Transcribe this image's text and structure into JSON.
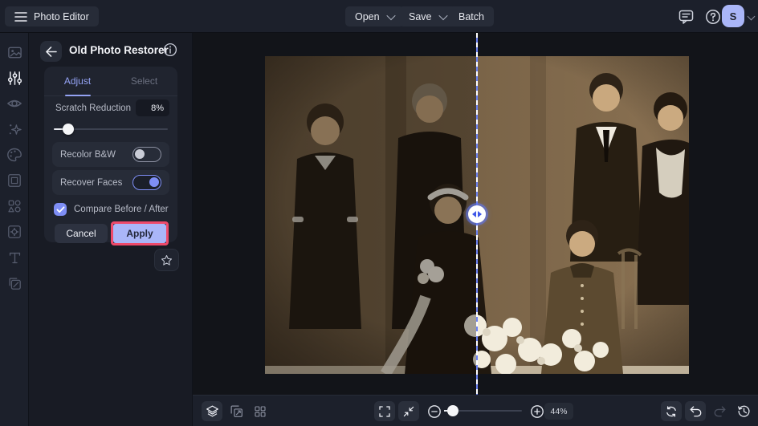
{
  "app": {
    "title": "Photo Editor"
  },
  "topbar": {
    "open_label": "Open",
    "save_label": "Save",
    "batch_label": "Batch",
    "avatar_initial": "S",
    "icons": [
      "hamburger-icon",
      "feedback-icon",
      "help-icon",
      "account-chevron-icon"
    ]
  },
  "tool_rail": {
    "items": [
      {
        "name": "image-tool-icon",
        "active": false
      },
      {
        "name": "adjust-tool-icon",
        "active": true
      },
      {
        "name": "eye-tool-icon",
        "active": false
      },
      {
        "name": "effects-tool-icon",
        "active": false
      },
      {
        "name": "paint-tool-icon",
        "active": false
      },
      {
        "name": "frame-tool-icon",
        "active": false
      },
      {
        "name": "elements-tool-icon",
        "active": false
      },
      {
        "name": "sticker-tool-icon",
        "active": false
      },
      {
        "name": "text-tool-icon",
        "active": false
      },
      {
        "name": "duplicate-tool-icon",
        "active": false
      }
    ]
  },
  "panel": {
    "title": "Old Photo Restorer",
    "tabs": [
      {
        "label": "Adjust",
        "active": true
      },
      {
        "label": "Select",
        "active": false
      }
    ],
    "scratch_reduction": {
      "label": "Scratch Reduction",
      "value": "8%",
      "slider_percent": 12
    },
    "toggles": [
      {
        "label": "Recolor B&W",
        "on": false
      },
      {
        "label": "Recover Faces",
        "on": true
      }
    ],
    "compare_checkbox": {
      "label": "Compare Before / After",
      "checked": true
    },
    "cancel_label": "Cancel",
    "apply_label": "Apply",
    "apply_highlighted": true
  },
  "canvas": {
    "content": "sepia family portrait photo, before/after comparison split at center",
    "divider_percent": 50
  },
  "toolbar": {
    "left_icons": [
      "layers-icon",
      "transform-icon",
      "grid-view-icon"
    ],
    "view_icons": [
      "fullscreen-icon",
      "fit-to-screen-icon"
    ],
    "zoom_out": "zoom-out-icon",
    "zoom_in": "zoom-in-icon",
    "zoom_level": "44%",
    "zoom_slider_percent": 10,
    "right_icons": [
      "reset-icon",
      "undo-icon",
      "redo-icon",
      "history-icon"
    ],
    "redo_enabled": false
  },
  "colors": {
    "accent_periwinkle": "#aab6f8",
    "tab_active": "#93a2f3",
    "highlight_pink": "#ee4a6b",
    "topbar_bg": "#1c202b",
    "panel_bg": "#181b24",
    "card_bg": "#20242f",
    "canvas_bg": "#121419",
    "divider_blue": "#6d83f3"
  }
}
